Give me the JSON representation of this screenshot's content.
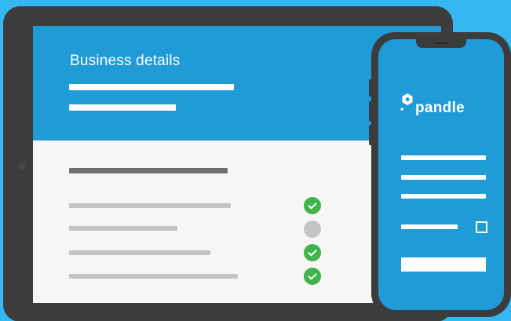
{
  "tablet": {
    "title": "Business details",
    "checklist": [
      {
        "state": "complete",
        "icon": "check-circle-icon"
      },
      {
        "state": "incomplete",
        "icon": "empty-circle-icon"
      },
      {
        "state": "complete",
        "icon": "check-circle-icon"
      },
      {
        "state": "complete",
        "icon": "check-circle-icon"
      }
    ]
  },
  "phone": {
    "brand": "pandle",
    "logo_icon": "pandle-logo-icon",
    "checkbox_checked": false
  },
  "colors": {
    "background": "#35b7ef",
    "brand_blue": "#1f9bd7",
    "device_frame": "#3c3c3c",
    "success": "#3fb44a",
    "pending": "#c4c4c4"
  }
}
